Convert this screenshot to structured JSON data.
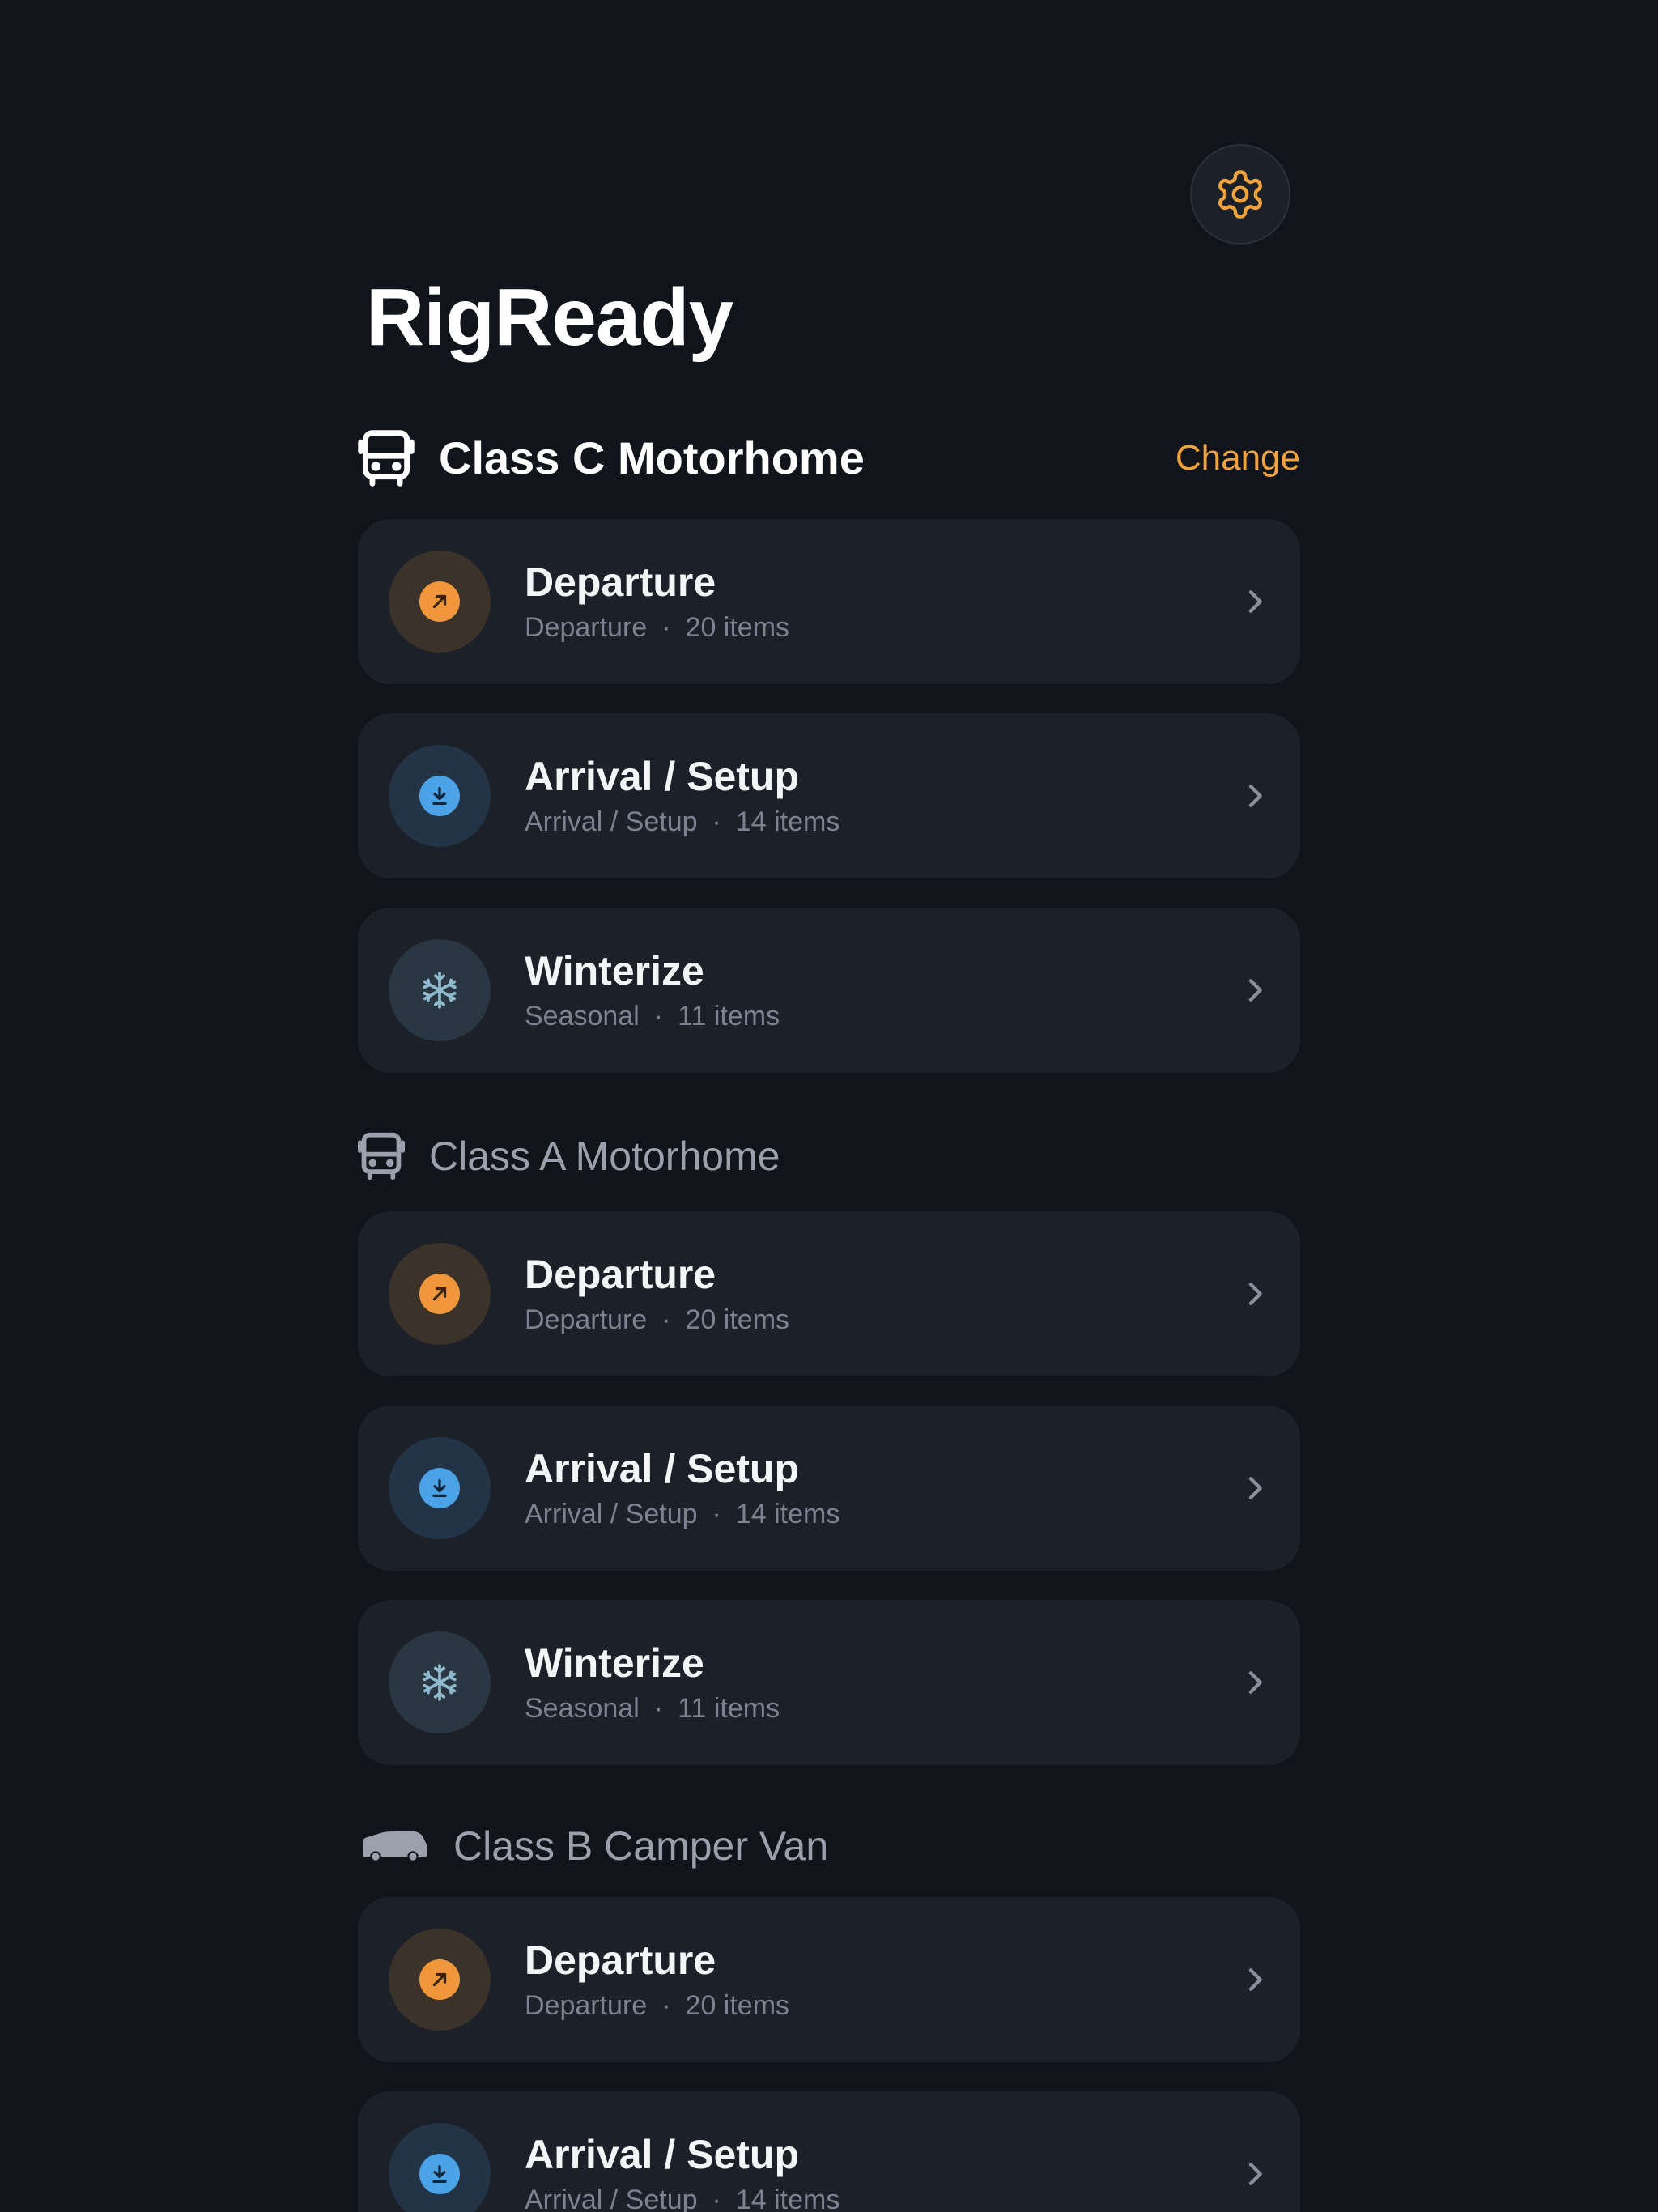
{
  "app": {
    "title": "RigReady"
  },
  "colors": {
    "background": "#11141b",
    "card": "#1b2029",
    "accent": "#f0a23d",
    "departure": "#ef973a",
    "arrival": "#4ba2e6",
    "winter": "#8fb9cc"
  },
  "sections": [
    {
      "vehicle": "Class C Motorhome",
      "icon": "bus-icon",
      "active": true,
      "change_label": "Change",
      "checklists": [
        {
          "title": "Departure",
          "category": "Departure",
          "sep": "·",
          "count": "20 items",
          "icon": "arrow-up-right-icon"
        },
        {
          "title": "Arrival / Setup",
          "category": "Arrival / Setup",
          "sep": "·",
          "count": "14 items",
          "icon": "download-icon"
        },
        {
          "title": "Winterize",
          "category": "Seasonal",
          "sep": "·",
          "count": "11 items",
          "icon": "snowflake-icon"
        }
      ]
    },
    {
      "vehicle": "Class A Motorhome",
      "icon": "bus-icon",
      "active": false,
      "checklists": [
        {
          "title": "Departure",
          "category": "Departure",
          "sep": "·",
          "count": "20 items",
          "icon": "arrow-up-right-icon"
        },
        {
          "title": "Arrival / Setup",
          "category": "Arrival / Setup",
          "sep": "·",
          "count": "14 items",
          "icon": "download-icon"
        },
        {
          "title": "Winterize",
          "category": "Seasonal",
          "sep": "·",
          "count": "11 items",
          "icon": "snowflake-icon"
        }
      ]
    },
    {
      "vehicle": "Class B Camper Van",
      "icon": "van-icon",
      "active": false,
      "checklists": [
        {
          "title": "Departure",
          "category": "Departure",
          "sep": "·",
          "count": "20 items",
          "icon": "arrow-up-right-icon"
        },
        {
          "title": "Arrival / Setup",
          "category": "Arrival / Setup",
          "sep": "·",
          "count": "14 items",
          "icon": "download-icon"
        }
      ]
    }
  ]
}
